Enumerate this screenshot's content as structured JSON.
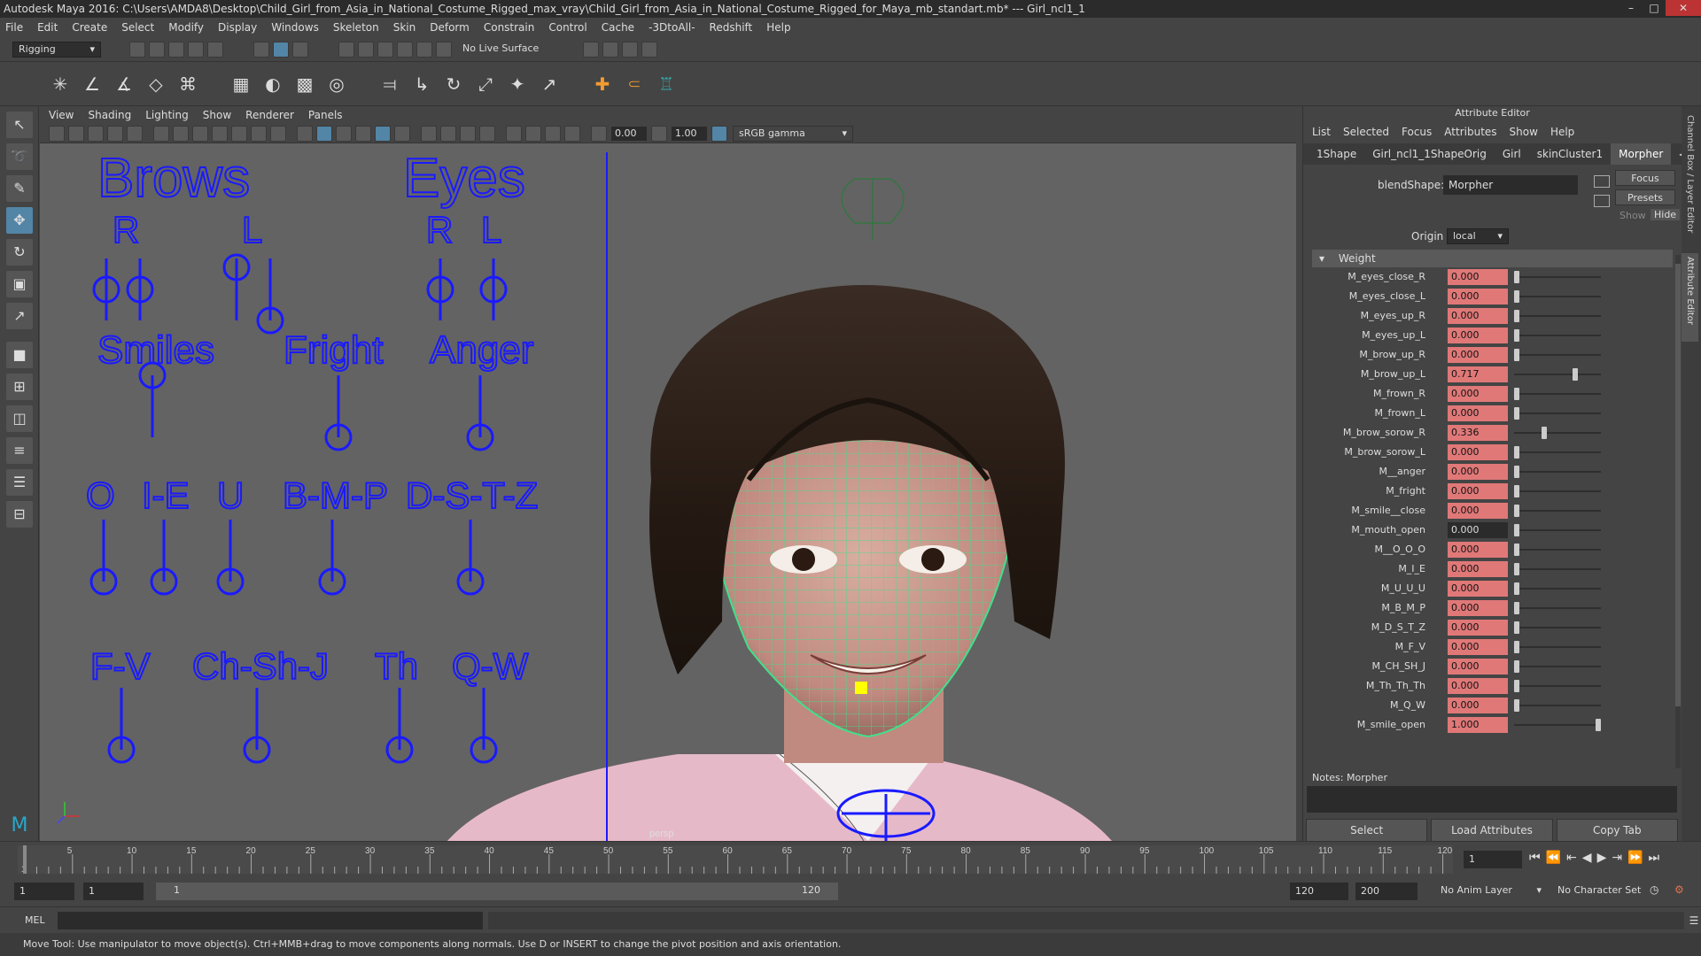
{
  "window": {
    "title": "Autodesk Maya 2016: C:\\Users\\AMDA8\\Desktop\\Child_Girl_from_Asia_in_National_Costume_Rigged_max_vray\\Child_Girl_from_Asia_in_National_Costume_Rigged_for_Maya_mb_standart.mb*   ---   Girl_ncl1_1"
  },
  "menu": [
    "File",
    "Edit",
    "Create",
    "Select",
    "Modify",
    "Display",
    "Windows",
    "Skeleton",
    "Skin",
    "Deform",
    "Constrain",
    "Control",
    "Cache",
    "-3DtoAll-",
    "Redshift",
    "Help"
  ],
  "status": {
    "menuset": "Rigging",
    "live_surface": "No Live Surface"
  },
  "viewport": {
    "menu": [
      "View",
      "Shading",
      "Lighting",
      "Show",
      "Renderer",
      "Panels"
    ],
    "exposure": "0.00",
    "gamma": "1.00",
    "colorspace": "sRGB gamma",
    "camera_label": "persp",
    "face_ui": {
      "brows": "Brows",
      "eyes": "Eyes",
      "r": "R",
      "l": "L",
      "smiles": "Smiles",
      "fright": "Fright",
      "anger": "Anger",
      "o": "O",
      "ie": "I-E",
      "u": "U",
      "bmp": "B-M-P",
      "dstz": "D-S-T-Z",
      "fv": "F-V",
      "chshj": "Ch-Sh-J",
      "th": "Th",
      "qw": "Q-W"
    }
  },
  "attribute_editor": {
    "title": "Attribute Editor",
    "menu": [
      "List",
      "Selected",
      "Focus",
      "Attributes",
      "Show",
      "Help"
    ],
    "tabs": [
      "1Shape",
      "Girl_ncl1_1ShapeOrig",
      "Girl",
      "skinCluster1",
      "Morpher"
    ],
    "active_tab": "Morpher",
    "blendshape_label": "blendShape:",
    "blendshape_value": "Morpher",
    "focus_btn": "Focus",
    "presets_btn": "Presets",
    "show_label": "Show",
    "hide_label": "Hide",
    "origin_label": "Origin",
    "origin_value": "local",
    "section": "Weight",
    "weights": [
      {
        "name": "M_eyes_close_R",
        "value": "0.000",
        "level": 0.0
      },
      {
        "name": "M_eyes_close_L",
        "value": "0.000",
        "level": 0.0
      },
      {
        "name": "M_eyes_up_R",
        "value": "0.000",
        "level": 0.0
      },
      {
        "name": "M_eyes_up_L",
        "value": "0.000",
        "level": 0.0
      },
      {
        "name": "M_brow_up_R",
        "value": "0.000",
        "level": 0.0
      },
      {
        "name": "M_brow_up_L",
        "value": "0.717",
        "level": 0.717
      },
      {
        "name": "M_frown_R",
        "value": "0.000",
        "level": 0.0
      },
      {
        "name": "M_frown_L",
        "value": "0.000",
        "level": 0.0
      },
      {
        "name": "M_brow_sorow_R",
        "value": "0.336",
        "level": 0.336
      },
      {
        "name": "M_brow_sorow_L",
        "value": "0.000",
        "level": 0.0
      },
      {
        "name": "M__anger",
        "value": "0.000",
        "level": 0.0
      },
      {
        "name": "M_fright",
        "value": "0.000",
        "level": 0.0
      },
      {
        "name": "M_smile__close",
        "value": "0.000",
        "level": 0.0
      },
      {
        "name": "M_mouth_open",
        "value": "0.000",
        "level": 0.0,
        "plain": true
      },
      {
        "name": "M__O_O_O",
        "value": "0.000",
        "level": 0.0
      },
      {
        "name": "M_I_E",
        "value": "0.000",
        "level": 0.0
      },
      {
        "name": "M_U_U_U",
        "value": "0.000",
        "level": 0.0
      },
      {
        "name": "M_B_M_P",
        "value": "0.000",
        "level": 0.0
      },
      {
        "name": "M_D_S_T_Z",
        "value": "0.000",
        "level": 0.0
      },
      {
        "name": "M_F_V",
        "value": "0.000",
        "level": 0.0
      },
      {
        "name": "M_CH_SH_J",
        "value": "0.000",
        "level": 0.0
      },
      {
        "name": "M_Th_Th_Th",
        "value": "0.000",
        "level": 0.0
      },
      {
        "name": "M_Q_W",
        "value": "0.000",
        "level": 0.0
      },
      {
        "name": "M_smile_open",
        "value": "1.000",
        "level": 1.0
      }
    ],
    "notes_label": "Notes:",
    "notes_value": "Morpher",
    "select_btn": "Select",
    "load_btn": "Load Attributes",
    "copy_btn": "Copy Tab",
    "side_tabs": [
      "Channel Box / Layer Editor",
      "Attribute Editor"
    ]
  },
  "timeline": {
    "ticks": [
      "5",
      "10",
      "15",
      "20",
      "25",
      "30",
      "35",
      "40",
      "45",
      "50",
      "55",
      "60",
      "65",
      "70",
      "75",
      "80",
      "85",
      "90",
      "95",
      "100",
      "105",
      "110",
      "115",
      "120"
    ],
    "current_frame": "1",
    "first_tick": "1"
  },
  "range": {
    "start": "1",
    "start2": "1",
    "slider_start": "1",
    "slider_end": "120",
    "end": "120",
    "end2": "200",
    "anim_layer": "No Anim Layer",
    "char_set": "No Character Set"
  },
  "cmdline": {
    "label": "MEL"
  },
  "help": "Move Tool: Use manipulator to move object(s). Ctrl+MMB+drag to move components along normals. Use D or INSERT to change the pivot position and axis orientation.",
  "colors": {
    "accent": "#5285a6",
    "field_keyed": "#e07878",
    "rig_blue": "#1a1aff",
    "wire": "#41e08a",
    "skin": "#c99a8a",
    "hair": "#2b1f19",
    "robe": "#e6b9c9"
  }
}
